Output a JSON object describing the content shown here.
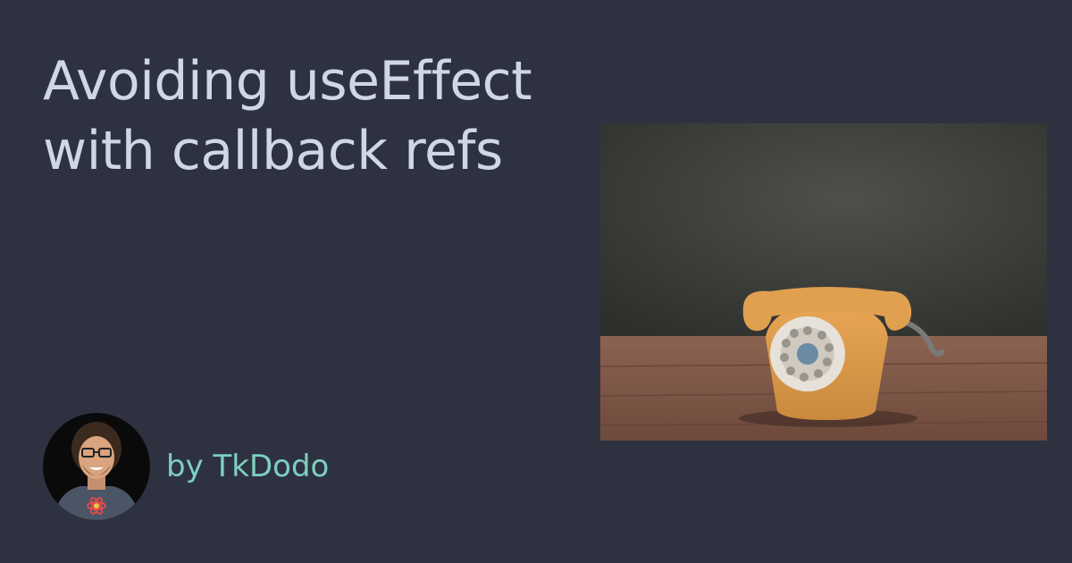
{
  "post": {
    "title_line1": "Avoiding useEffect",
    "title_line2": "with callback refs",
    "byline": "by TkDodo"
  },
  "colors": {
    "background": "#2e3240",
    "title": "#cfd6e4",
    "byline": "#7dcfc0"
  },
  "images": {
    "avatar": "author-portrait",
    "hero": "vintage-rotary-telephone"
  }
}
